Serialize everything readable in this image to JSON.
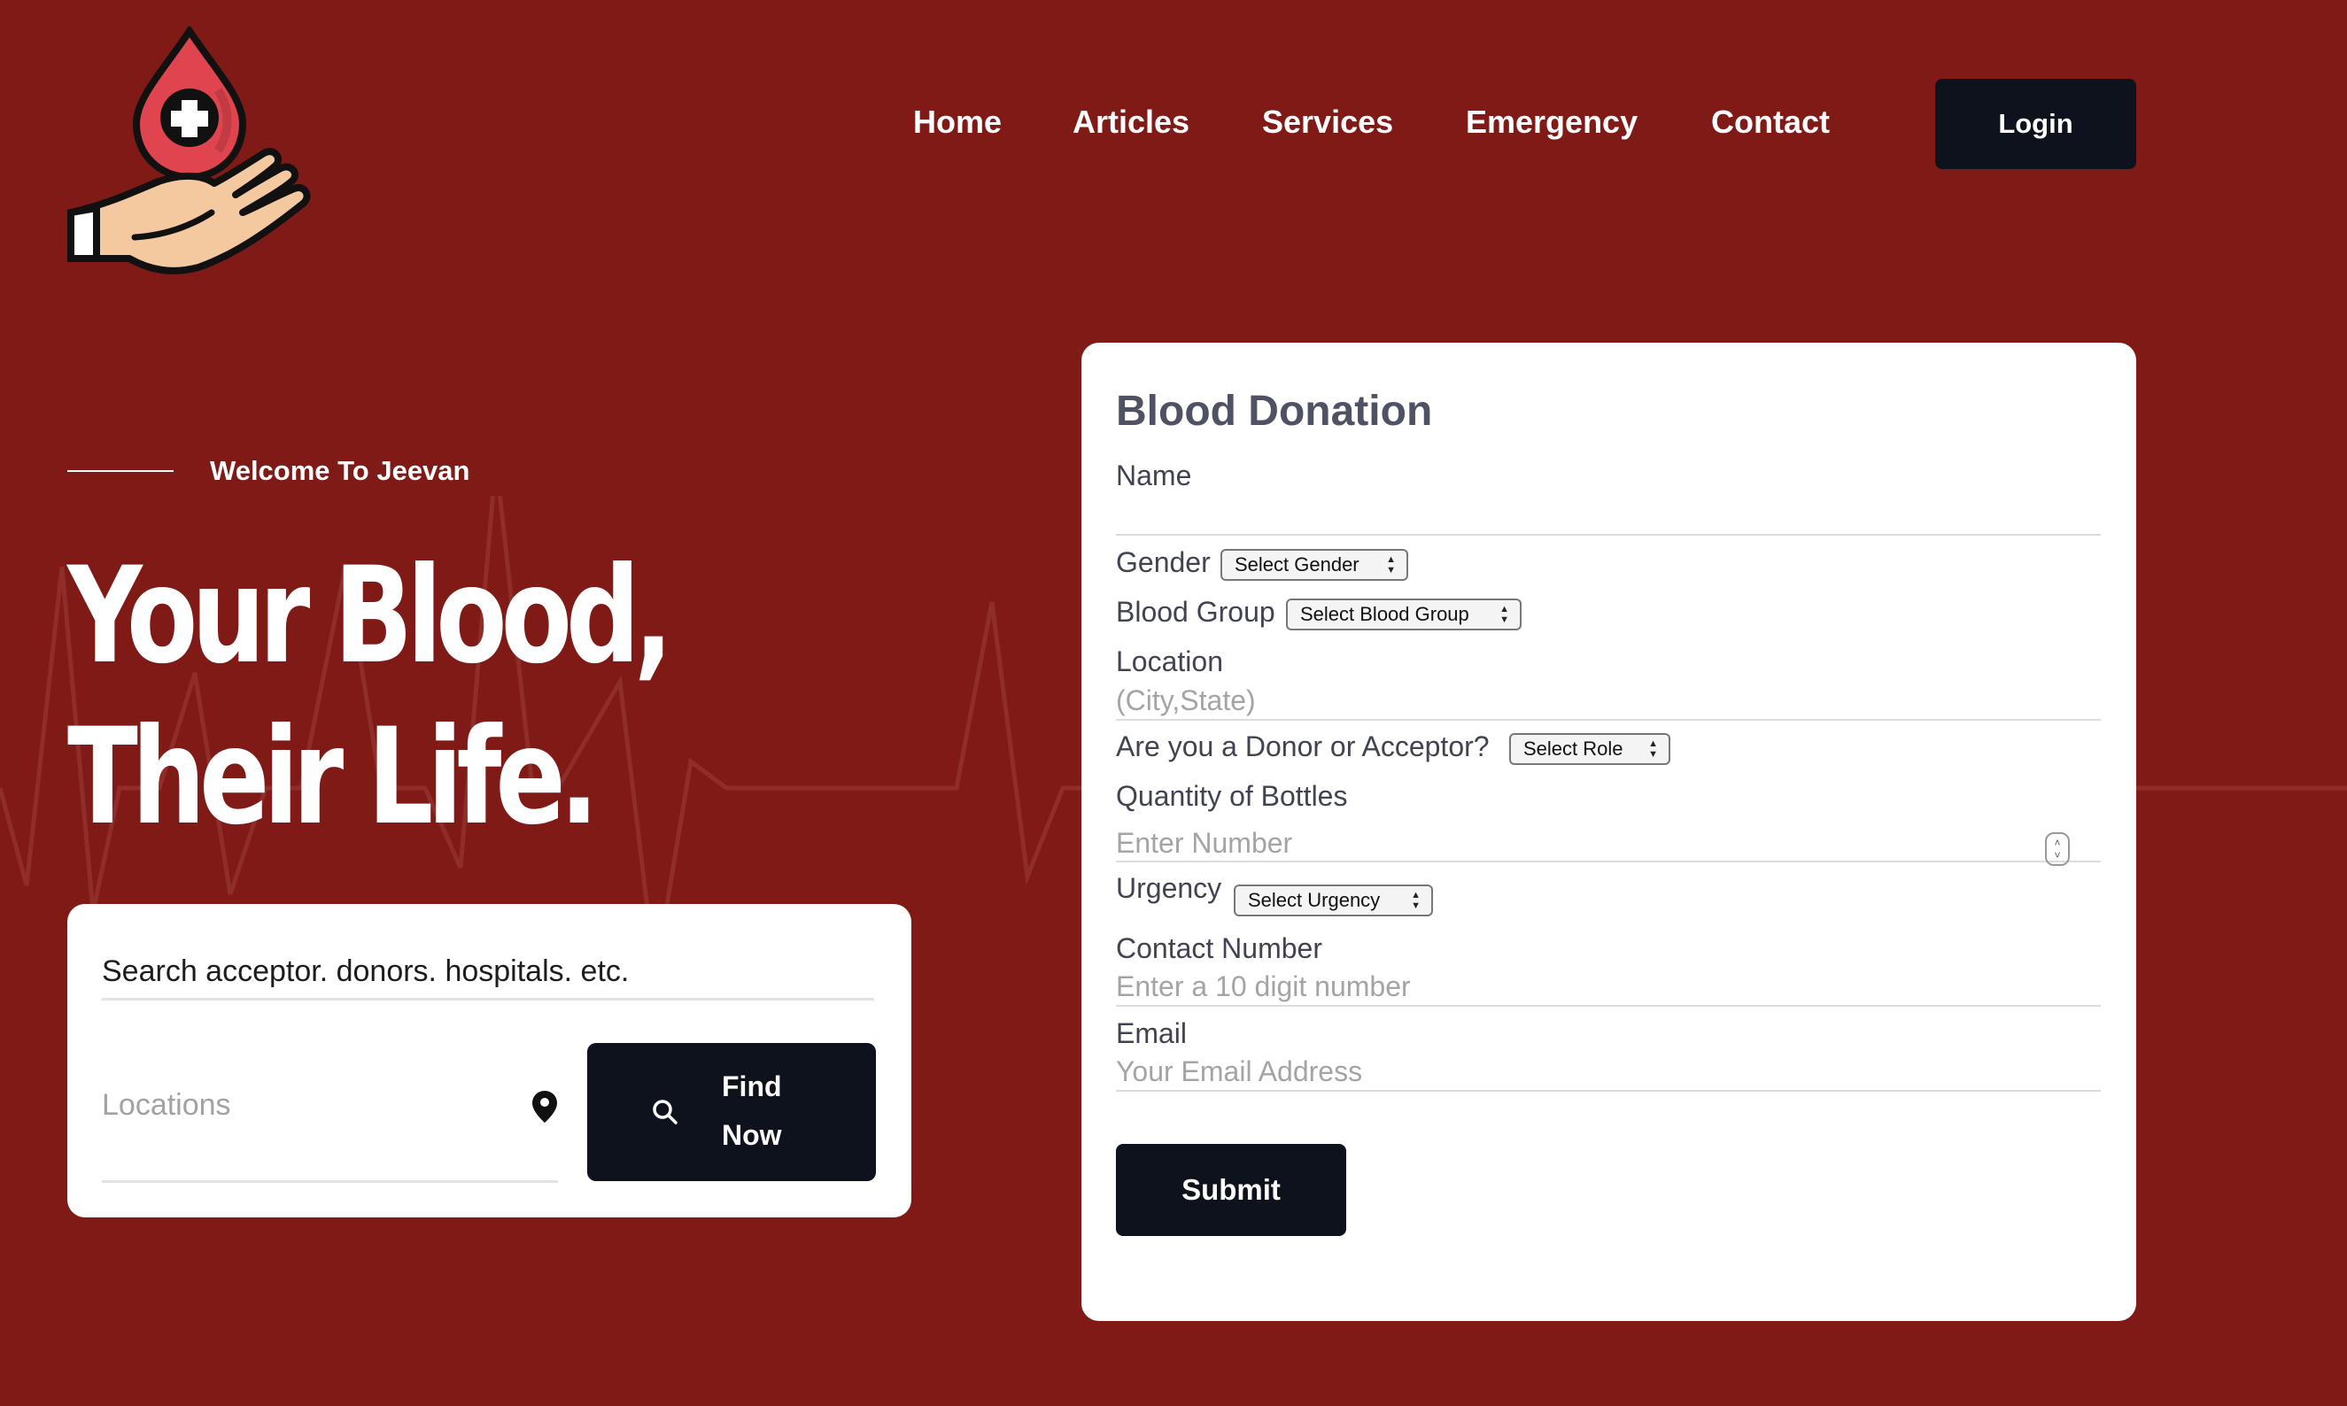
{
  "brand": {
    "logo_icon": "blood-drop-hand-icon",
    "accent": "#7f1a16",
    "dark": "#0d121c",
    "drop_color": "#e0454f"
  },
  "nav": {
    "items": [
      {
        "label": "Home"
      },
      {
        "label": "Articles"
      },
      {
        "label": "Services"
      },
      {
        "label": "Emergency"
      },
      {
        "label": "Contact"
      }
    ],
    "login_label": "Login"
  },
  "hero": {
    "welcome": "Welcome To Jeevan",
    "title_line1": "Your Blood,",
    "title_line2": "Their Life."
  },
  "search": {
    "main_placeholder": "Search acceptor. donors. hospitals. etc.",
    "location_placeholder": "Locations",
    "location_icon": "map-pin-icon",
    "button_icon": "search-icon",
    "button_label_line1": "Find",
    "button_label_line2": "Now"
  },
  "form": {
    "title": "Blood Donation",
    "name_label": "Name",
    "gender_label": "Gender",
    "gender_selected": "Select Gender",
    "blood_group_label": "Blood Group",
    "blood_group_selected": "Select Blood Group",
    "location_label": "Location",
    "location_placeholder": "(City,State)",
    "role_label": "Are you a Donor or Acceptor?",
    "role_selected": "Select Role",
    "quantity_label": "Quantity of Bottles",
    "quantity_placeholder": "Enter Number",
    "urgency_label": "Urgency",
    "urgency_selected": "Select Urgency",
    "contact_label": "Contact Number",
    "contact_placeholder": "Enter a 10 digit number",
    "email_label": "Email",
    "email_placeholder": "Your Email Address",
    "submit_label": "Submit"
  }
}
